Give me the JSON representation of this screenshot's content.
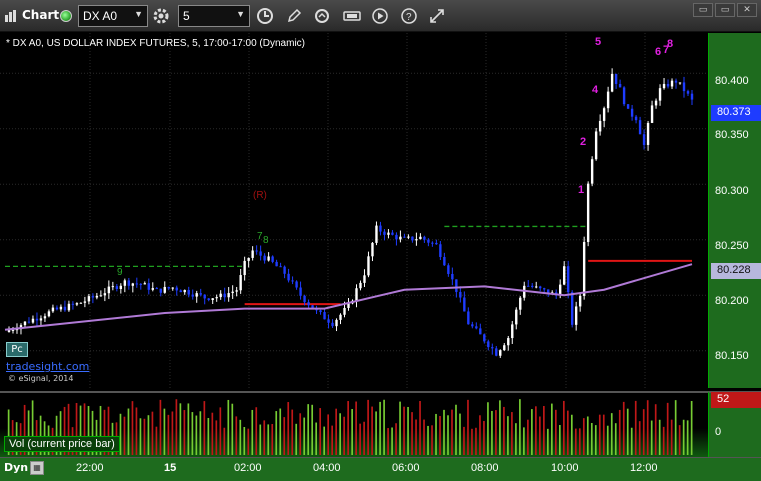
{
  "toolbar": {
    "title": "Chart",
    "symbol": "DX A0",
    "interval": "5",
    "dropdown_glyph": "▼",
    "icons": [
      "chart-icon",
      "gear-icon",
      "clock-icon",
      "pencil-icon",
      "refresh-icon",
      "tools-icon",
      "play-icon",
      "question-icon",
      "link-icon"
    ],
    "window_buttons": [
      "▭",
      "▭",
      "✕"
    ]
  },
  "chart": {
    "legend": "* DX A0, US DOLLAR INDEX FUTURES, 5, 17:00-17:00 (Dynamic)",
    "pc_badge": "Pc",
    "brand_link": "tradesight.com",
    "copyright": "© eSignal, 2014",
    "marker_r": "(R)",
    "last_price": "80.373",
    "ma_value": "80.228",
    "price_ticks": [
      "80.400",
      "80.350",
      "80.300",
      "80.250",
      "80.200",
      "80.150"
    ],
    "colors": {
      "up": "#ffffff",
      "down": "#1e3cff",
      "ma": "#b07ad6",
      "pivot_green": "#1fa01f",
      "pivot_red": "#e01515",
      "count_green": "#2aa82a",
      "count_magenta": "#e020e0",
      "axis_bg": "#1e6b1e",
      "last_price_bg": "#1e3cff"
    },
    "counts_magenta": [
      "5",
      "6",
      "7",
      "8",
      "4",
      "2",
      "1"
    ],
    "counts_green": [
      "9",
      "7",
      "8"
    ]
  },
  "volume": {
    "label": "Vol (current price bar)",
    "current_value": "52",
    "ticks": [
      "0"
    ],
    "colors": {
      "up": "#77cc33",
      "down": "#c01818"
    }
  },
  "time_axis": {
    "mode": "Dyn",
    "labels": [
      "22:00",
      "15",
      "02:00",
      "04:00",
      "06:00",
      "08:00",
      "10:00",
      "12:00"
    ]
  },
  "chart_data": {
    "type": "candlestick",
    "symbol": "DX A0",
    "interval": "5",
    "y_range": [
      80.13,
      80.42
    ],
    "y_ticks": [
      80.15,
      80.2,
      80.25,
      80.3,
      80.35,
      80.4
    ],
    "x_ticks": [
      "22:00",
      "15",
      "02:00",
      "04:00",
      "06:00",
      "08:00",
      "10:00",
      "12:00"
    ],
    "last_price": 80.373,
    "ma_last": 80.228,
    "price_path": [
      [
        0,
        80.167
      ],
      [
        6,
        80.177
      ],
      [
        12,
        80.186
      ],
      [
        18,
        80.192
      ],
      [
        22,
        80.198
      ],
      [
        26,
        80.205
      ],
      [
        30,
        80.212
      ],
      [
        34,
        80.21
      ],
      [
        38,
        80.204
      ],
      [
        42,
        80.207
      ],
      [
        46,
        80.203
      ],
      [
        50,
        80.198
      ],
      [
        54,
        80.199
      ],
      [
        58,
        80.205
      ],
      [
        60,
        80.228
      ],
      [
        62,
        80.24
      ],
      [
        66,
        80.232
      ],
      [
        70,
        80.22
      ],
      [
        74,
        80.2
      ],
      [
        78,
        80.185
      ],
      [
        82,
        80.175
      ],
      [
        86,
        80.19
      ],
      [
        90,
        80.22
      ],
      [
        93,
        80.26
      ],
      [
        96,
        80.255
      ],
      [
        100,
        80.25
      ],
      [
        104,
        80.252
      ],
      [
        108,
        80.245
      ],
      [
        110,
        80.23
      ],
      [
        113,
        80.205
      ],
      [
        116,
        80.175
      ],
      [
        120,
        80.16
      ],
      [
        123,
        80.148
      ],
      [
        126,
        80.162
      ],
      [
        130,
        80.21
      ],
      [
        134,
        80.205
      ],
      [
        138,
        80.2
      ],
      [
        140,
        80.225
      ],
      [
        142,
        80.175
      ],
      [
        144,
        80.2
      ],
      [
        146,
        80.3
      ],
      [
        148,
        80.35
      ],
      [
        150,
        80.37
      ],
      [
        152,
        80.4
      ],
      [
        154,
        80.385
      ],
      [
        156,
        80.365
      ],
      [
        158,
        80.36
      ],
      [
        160,
        80.335
      ],
      [
        162,
        80.37
      ],
      [
        164,
        80.385
      ],
      [
        166,
        80.39
      ],
      [
        168,
        80.393
      ],
      [
        170,
        80.385
      ],
      [
        172,
        80.375
      ]
    ],
    "ma_path": [
      [
        0,
        80.169
      ],
      [
        40,
        80.184
      ],
      [
        60,
        80.188
      ],
      [
        80,
        80.188
      ],
      [
        100,
        80.205
      ],
      [
        120,
        80.208
      ],
      [
        140,
        80.2
      ],
      [
        150,
        80.205
      ],
      [
        172,
        80.228
      ]
    ],
    "green_levels": [
      {
        "from": 0,
        "to": 60,
        "value": 80.226
      },
      {
        "from": 110,
        "to": 146,
        "value": 80.262
      }
    ],
    "red_levels": [
      {
        "from": 60,
        "to": 84,
        "value": 80.192
      },
      {
        "from": 146,
        "to": 172,
        "value": 80.231
      }
    ]
  }
}
